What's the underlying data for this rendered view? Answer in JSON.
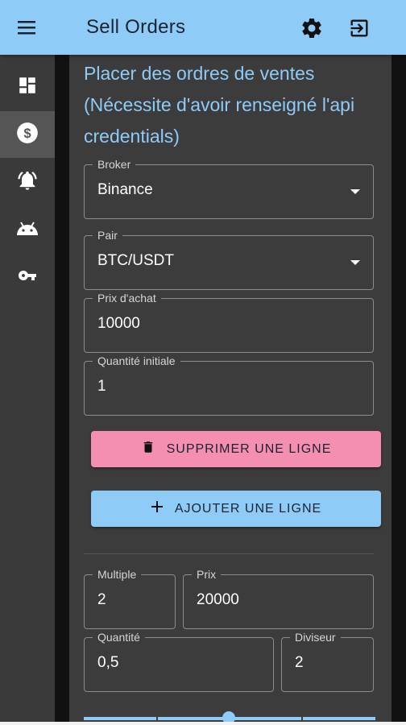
{
  "header": {
    "title": "Sell Orders"
  },
  "sidebar": {
    "items": [
      {
        "icon": "dashboard-icon",
        "active": false
      },
      {
        "icon": "dollar-icon",
        "active": true
      },
      {
        "icon": "alarm-bell-icon",
        "active": false
      },
      {
        "icon": "android-icon",
        "active": false
      },
      {
        "icon": "key-icon",
        "active": false
      }
    ]
  },
  "form": {
    "heading": "Placer des ordres de ventes (Nécessite d'avoir renseigné l'api credentials)",
    "broker": {
      "label": "Broker",
      "value": "Binance"
    },
    "pair": {
      "label": "Pair",
      "value": "BTC/USDT"
    },
    "prix_achat": {
      "label": "Prix d'achat",
      "value": "10000"
    },
    "quantite_initiale": {
      "label": "Quantité initiale",
      "value": "1"
    },
    "delete_button": "SUPPRIMER UNE LIGNE",
    "add_button": "AJOUTER UNE LIGNE"
  },
  "order_line": {
    "multiple": {
      "label": "Multiple",
      "value": "2"
    },
    "prix": {
      "label": "Prix",
      "value": "20000"
    },
    "quantite": {
      "label": "Quantité",
      "value": "0,5"
    },
    "diviseur": {
      "label": "Diviseur",
      "value": "2"
    }
  },
  "colors": {
    "accent": "#8ecbf7",
    "delete": "#f48fb1",
    "panel": "#3c3c3c",
    "sidebar": "#3a3a3a"
  }
}
